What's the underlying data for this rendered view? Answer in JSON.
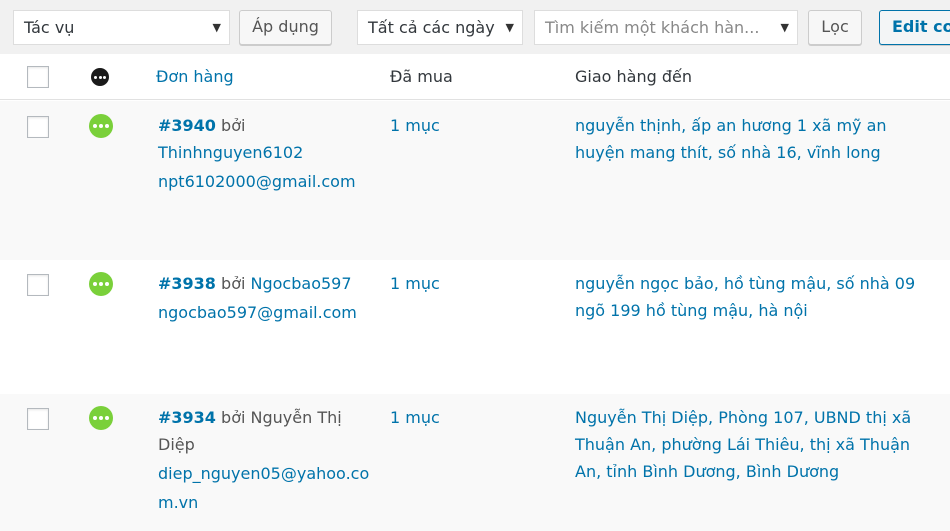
{
  "toolbar": {
    "bulk_action": "Tác vụ",
    "apply_label": "Áp dụng",
    "date_filter": "Tất cả các ngày",
    "customer_search_placeholder": "Tìm kiếm một khách hàn...",
    "filter_label": "Lọc",
    "edit_columns_label": "Edit col"
  },
  "table": {
    "headers": {
      "order": "Đơn hàng",
      "purchased": "Đã mua",
      "ship_to": "Giao hàng đến"
    },
    "rows": [
      {
        "order_number": "#3940",
        "by_label": "bởi",
        "customer": "Thinhnguyen6102",
        "email": "npt6102000@gmail.com",
        "purchased": "1 mục",
        "address_line1": "nguyễn thịnh, ấp an hương 1 xã mỹ an",
        "address_line2": "huyện mang thít, số nhà 16, vĩnh long"
      },
      {
        "order_number": "#3938",
        "by_label": "bởi",
        "customer": "Ngocbao597",
        "email": "ngocbao597@gmail.com",
        "purchased": "1 mục",
        "address_line1": "nguyễn ngọc bảo, hồ tùng mậu, số nhà 09",
        "address_line2": "ngõ 199 hồ tùng mậu, hà nội"
      },
      {
        "order_number": "#3934",
        "by_label": "bởi",
        "customer_line1": "Nguyễn Thị",
        "customer_line2": "Diệp",
        "email_line1": "diep_nguyen05@yahoo.co",
        "email_line2": "m.vn",
        "purchased": "1 mục",
        "address_line1": "Nguyễn Thị Diệp, Phòng 107, UBND thị xã",
        "address_line2": "Thuận An, phường Lái Thiêu, thị xã Thuận",
        "address_line3": "An, tỉnh Bình Dương, Bình Dương"
      }
    ]
  },
  "colors": {
    "link": "#0073aa",
    "status_processing": "#7ad03a"
  },
  "icons": [
    "caret-down-icon",
    "status-processing-icon",
    "status-header-icon"
  ]
}
